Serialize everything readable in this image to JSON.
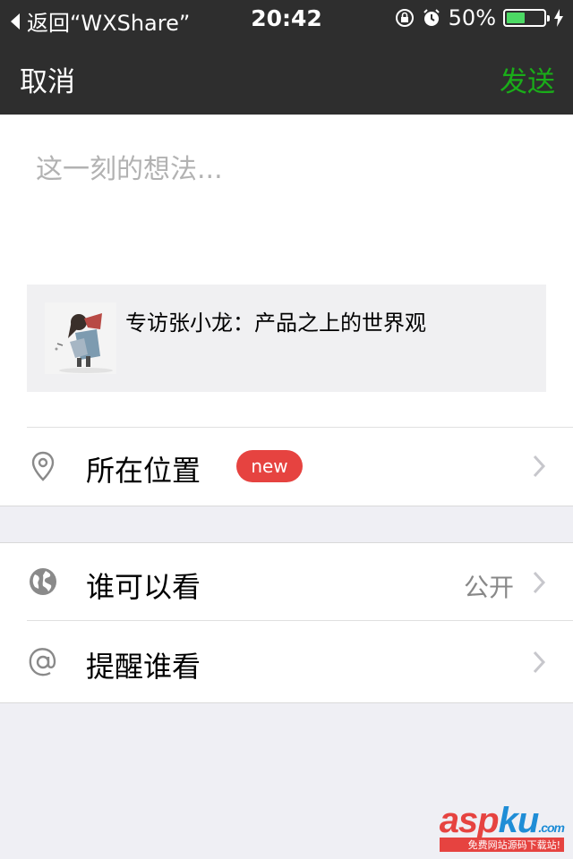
{
  "status_bar": {
    "back_app": "返回“WXShare”",
    "time": "20:42",
    "battery": "50%",
    "battery_level": 0.5
  },
  "nav": {
    "cancel": "取消",
    "send": "发送"
  },
  "compose": {
    "placeholder": "这一刻的想法..."
  },
  "link_card": {
    "title": "专访张小龙：产品之上的世界观"
  },
  "location": {
    "label": "所在位置",
    "badge": "new"
  },
  "visibility": {
    "label": "谁可以看",
    "value": "公开"
  },
  "mention": {
    "label": "提醒谁看"
  },
  "watermark": {
    "brand_a": "asp",
    "brand_b": "ku",
    "brand_c": ".com",
    "subtitle": "免费网站源码下载站!"
  },
  "colors": {
    "nav_bg": "#2e2e2e",
    "send_green": "#1aad19",
    "badge_red": "#e64340",
    "battery_green": "#4cd964"
  }
}
